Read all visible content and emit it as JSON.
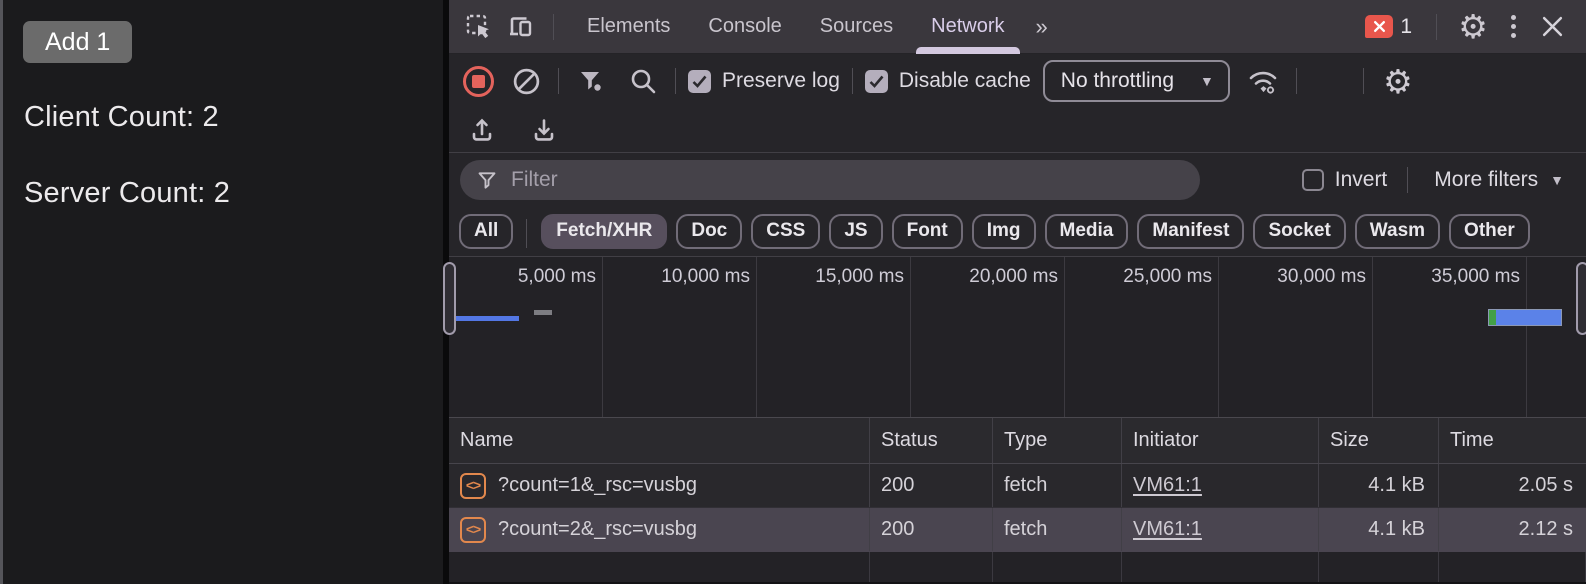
{
  "page": {
    "add_button": "Add 1",
    "client_count": "Client Count: 2",
    "server_count": "Server Count: 2"
  },
  "devtools": {
    "tabbar": {
      "tabs": [
        {
          "label": "Elements"
        },
        {
          "label": "Console"
        },
        {
          "label": "Sources"
        },
        {
          "label": "Network",
          "active": true
        }
      ],
      "error_count": "1"
    },
    "toolbar": {
      "preserve_log_label": "Preserve log",
      "disable_cache_label": "Disable cache",
      "throttling_value": "No throttling"
    },
    "filter_row": {
      "placeholder": "Filter",
      "invert_label": "Invert",
      "more_filters_label": "More filters"
    },
    "type_filters": [
      {
        "label": "All"
      },
      {
        "label": "Fetch/XHR",
        "selected": true
      },
      {
        "label": "Doc"
      },
      {
        "label": "CSS"
      },
      {
        "label": "JS"
      },
      {
        "label": "Font"
      },
      {
        "label": "Img"
      },
      {
        "label": "Media"
      },
      {
        "label": "Manifest"
      },
      {
        "label": "Socket"
      },
      {
        "label": "Wasm"
      },
      {
        "label": "Other"
      }
    ],
    "timeline": {
      "ticks": [
        "5,000 ms",
        "10,000 ms",
        "15,000 ms",
        "20,000 ms",
        "25,000 ms",
        "30,000 ms",
        "35,000 ms"
      ]
    },
    "table": {
      "columns": [
        {
          "label": "Name"
        },
        {
          "label": "Status"
        },
        {
          "label": "Type"
        },
        {
          "label": "Initiator"
        },
        {
          "label": "Size"
        },
        {
          "label": "Time"
        }
      ],
      "rows": [
        {
          "name": "?count=1&_rsc=vusbg",
          "status": "200",
          "type": "fetch",
          "initiator": "VM61:1",
          "size": "4.1 kB",
          "time": "2.05 s"
        },
        {
          "name": "?count=2&_rsc=vusbg",
          "status": "200",
          "type": "fetch",
          "initiator": "VM61:1",
          "size": "4.1 kB",
          "time": "2.12 s",
          "selected": true
        }
      ],
      "fetch_icon_glyph": "<>"
    },
    "icons": {
      "gear_glyph": "⚙",
      "more_tabs_glyph": "»",
      "throttle_caret": "▼",
      "more_filters_caret": "▼"
    },
    "colors": {
      "record_red": "#e4635c",
      "error_badge_red": "#e8564c",
      "fetch_icon_orange": "#e2884d",
      "waterfall_blue": "#5b82e8",
      "waterfall_green": "#43a047",
      "active_tab_underline": "#d3c8df",
      "selected_row_bg": "#4a4550"
    }
  }
}
